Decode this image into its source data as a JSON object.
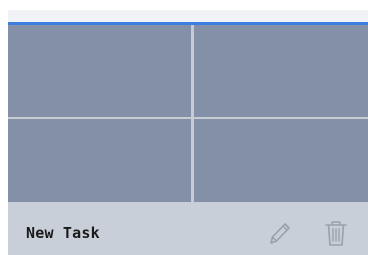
{
  "task": {
    "name": "New Task"
  },
  "actions": {
    "edit_icon": "pencil-icon",
    "delete_icon": "trash-icon"
  },
  "colors": {
    "accent": "#3d7fe0",
    "tile": "#8490a8",
    "task_bar": "#c9cfd8",
    "icon": "#9aa0a8"
  }
}
